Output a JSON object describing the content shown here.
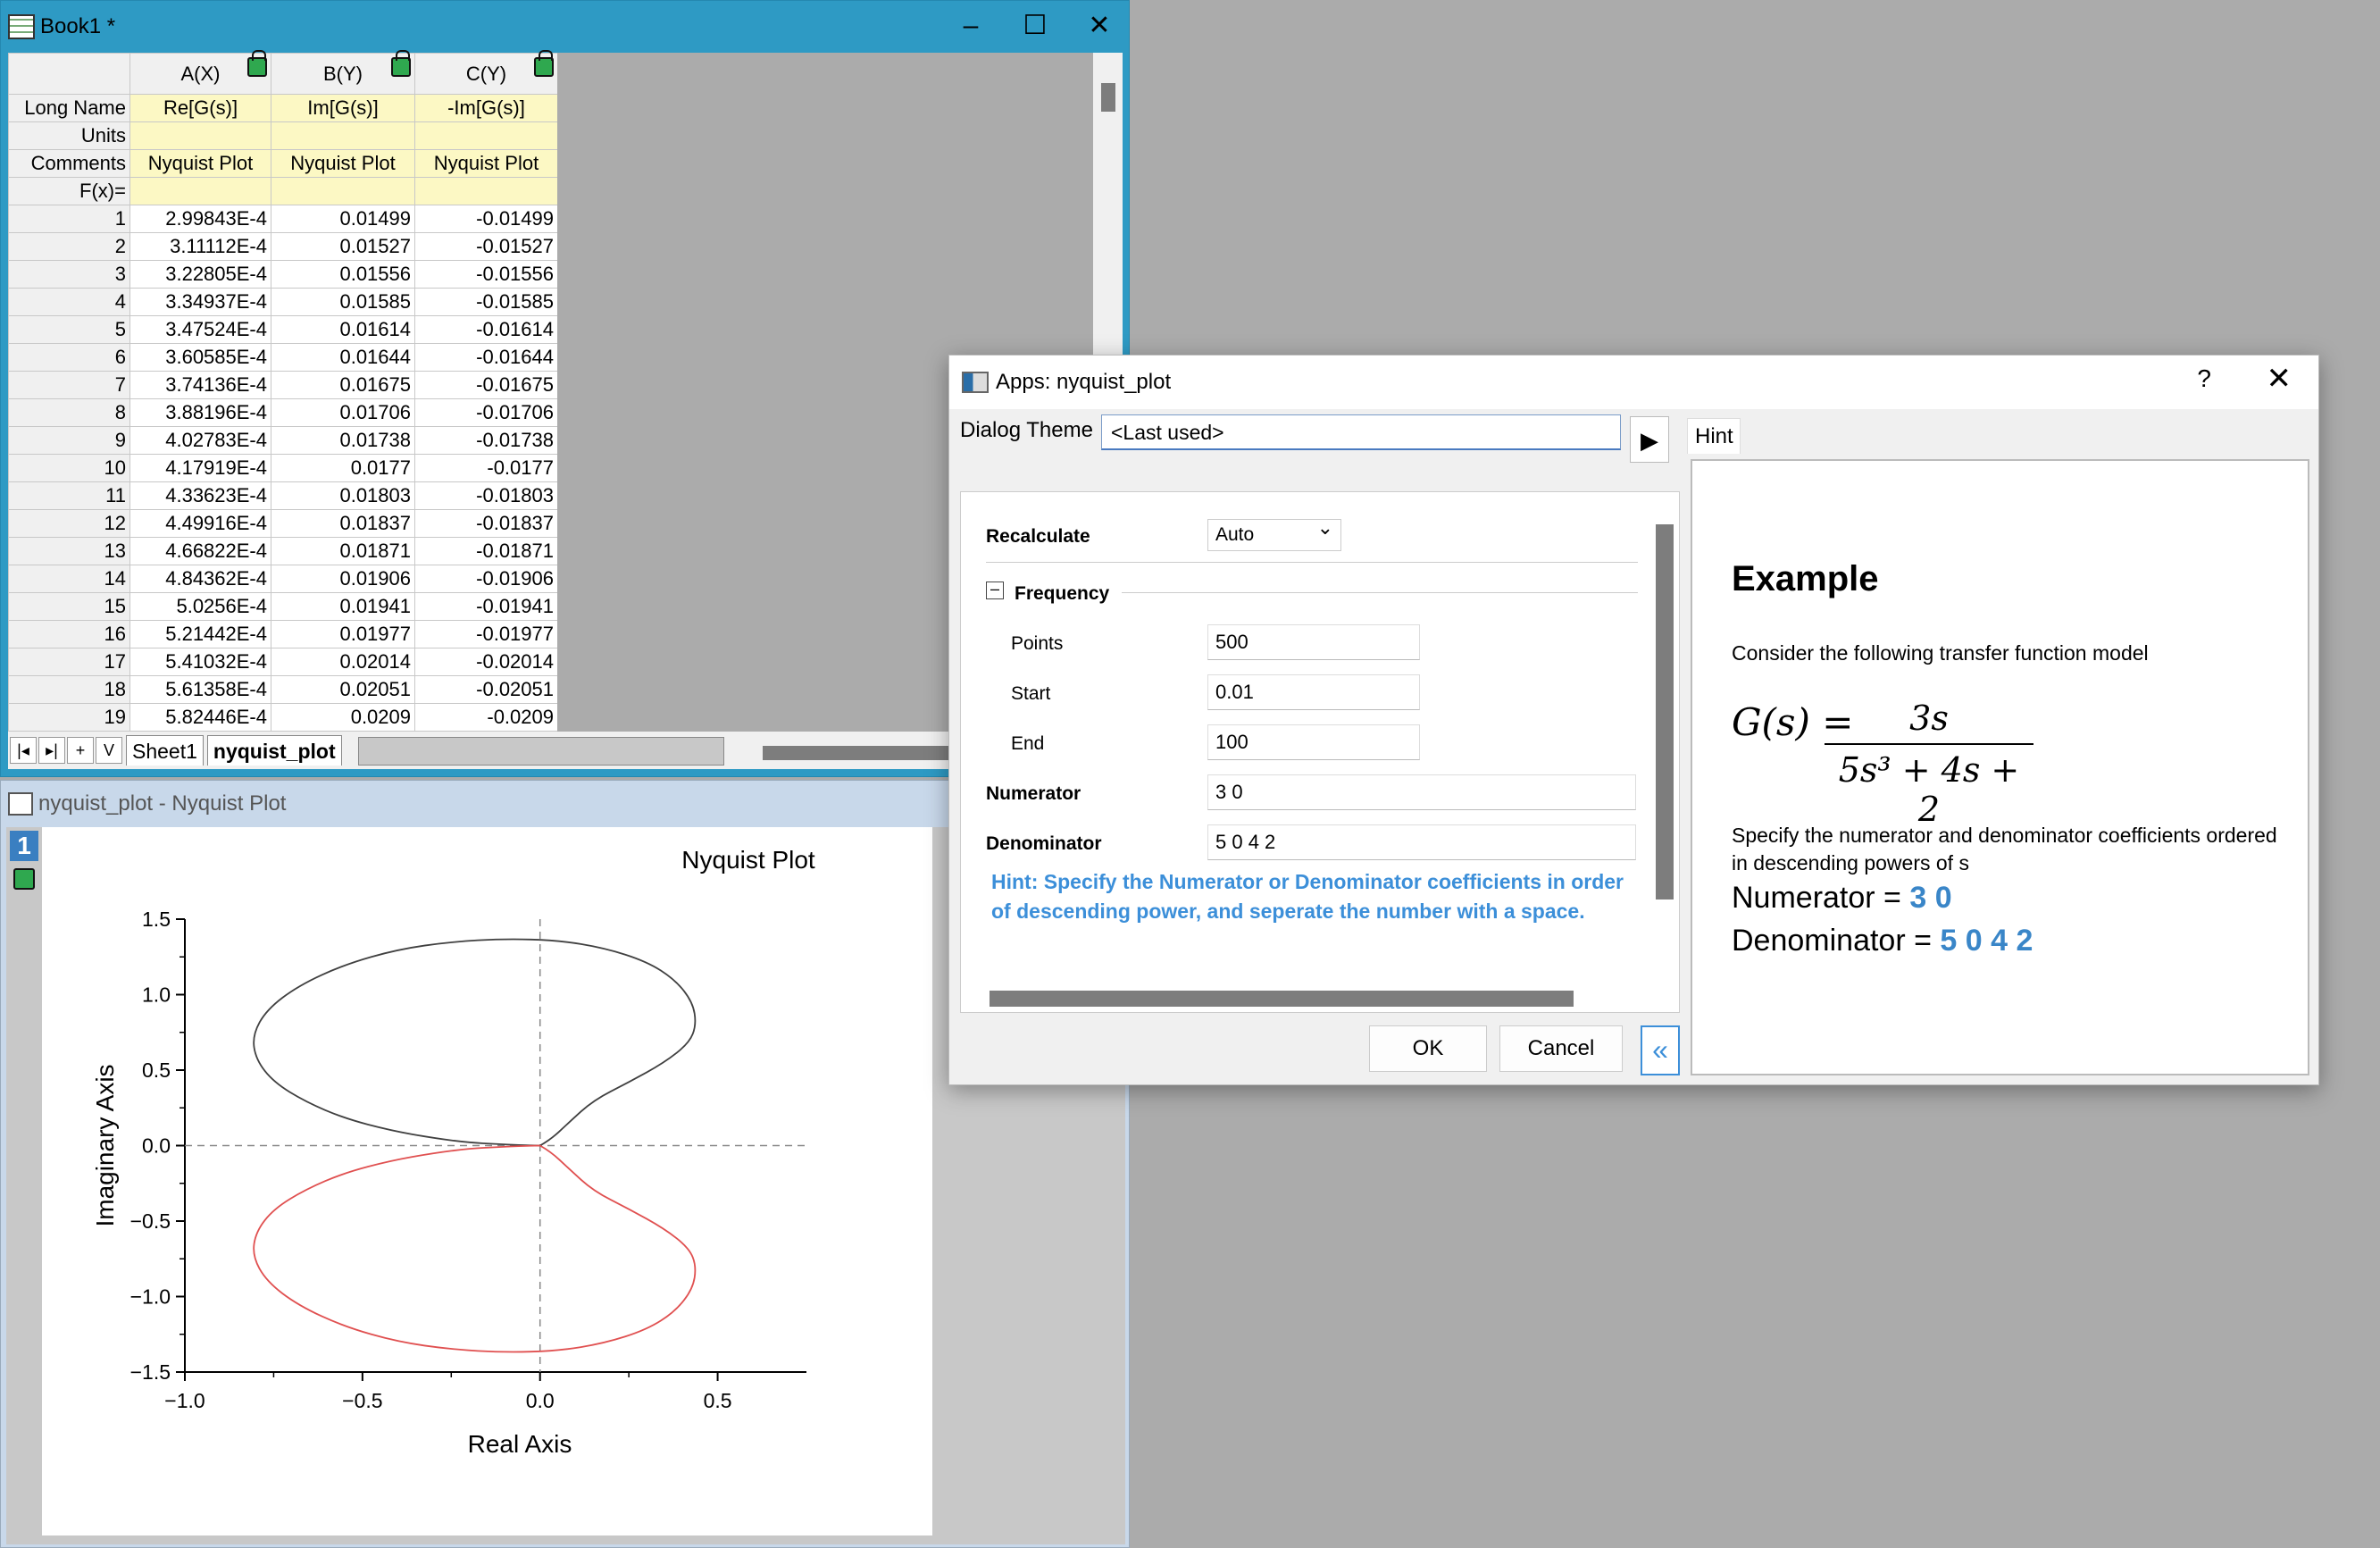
{
  "book": {
    "title": "Book1 *",
    "columns": [
      {
        "header": "A(X)",
        "long_name": "Re[G(s)]",
        "units": "",
        "comments": "Nyquist Plot"
      },
      {
        "header": "B(Y)",
        "long_name": "Im[G(s)]",
        "units": "",
        "comments": "Nyquist Plot"
      },
      {
        "header": "C(Y)",
        "long_name": "-Im[G(s)]",
        "units": "",
        "comments": "Nyquist Plot"
      }
    ],
    "row_labels": {
      "long_name": "Long Name",
      "units": "Units",
      "comments": "Comments",
      "fx": "F(x)="
    },
    "rows": [
      [
        "1",
        "2.99843E-4",
        "0.01499",
        "-0.01499"
      ],
      [
        "2",
        "3.11112E-4",
        "0.01527",
        "-0.01527"
      ],
      [
        "3",
        "3.22805E-4",
        "0.01556",
        "-0.01556"
      ],
      [
        "4",
        "3.34937E-4",
        "0.01585",
        "-0.01585"
      ],
      [
        "5",
        "3.47524E-4",
        "0.01614",
        "-0.01614"
      ],
      [
        "6",
        "3.60585E-4",
        "0.01644",
        "-0.01644"
      ],
      [
        "7",
        "3.74136E-4",
        "0.01675",
        "-0.01675"
      ],
      [
        "8",
        "3.88196E-4",
        "0.01706",
        "-0.01706"
      ],
      [
        "9",
        "4.02783E-4",
        "0.01738",
        "-0.01738"
      ],
      [
        "10",
        "4.17919E-4",
        "0.0177",
        "-0.0177"
      ],
      [
        "11",
        "4.33623E-4",
        "0.01803",
        "-0.01803"
      ],
      [
        "12",
        "4.49916E-4",
        "0.01837",
        "-0.01837"
      ],
      [
        "13",
        "4.66822E-4",
        "0.01871",
        "-0.01871"
      ],
      [
        "14",
        "4.84362E-4",
        "0.01906",
        "-0.01906"
      ],
      [
        "15",
        "5.0256E-4",
        "0.01941",
        "-0.01941"
      ],
      [
        "16",
        "5.21442E-4",
        "0.01977",
        "-0.01977"
      ],
      [
        "17",
        "5.41032E-4",
        "0.02014",
        "-0.02014"
      ],
      [
        "18",
        "5.61358E-4",
        "0.02051",
        "-0.02051"
      ],
      [
        "19",
        "5.82446E-4",
        "0.0209",
        "-0.0209"
      ]
    ],
    "tabs": [
      "Sheet1",
      "nyquist_plot"
    ],
    "nav": [
      "|◂",
      "▸|",
      "+",
      "V"
    ]
  },
  "graph": {
    "title": "nyquist_plot - Nyquist Plot",
    "layer_number": "1"
  },
  "chart_data": {
    "type": "line",
    "title": "Nyquist Plot",
    "xlabel": "Real Axis",
    "ylabel": "Imaginary Axis",
    "xlim": [
      -1.0,
      0.75
    ],
    "ylim": [
      -1.5,
      1.5
    ],
    "xticks": [
      "−1.0",
      "−0.5",
      "0.0",
      "0.5"
    ],
    "xtick_values": [
      -1.0,
      -0.5,
      0.0,
      0.5
    ],
    "yticks": [
      "1.5",
      "1.0",
      "0.5",
      "0.0",
      "−0.5",
      "−1.0",
      "−1.5"
    ],
    "ytick_values": [
      1.5,
      1.0,
      0.5,
      0.0,
      -0.5,
      -1.0,
      -1.5
    ],
    "grid": false,
    "reference_lines": {
      "x": 0.0,
      "y": 0.0
    },
    "series": [
      {
        "color": "#404040",
        "x": [
          0.0,
          0.03,
          0.08,
          0.15,
          0.25,
          0.35,
          0.42,
          0.44,
          0.43,
          0.38,
          0.3,
          0.18,
          0.05,
          -0.1,
          -0.25,
          -0.4,
          -0.55,
          -0.68,
          -0.77,
          -0.81,
          -0.8,
          -0.75,
          -0.66,
          -0.55,
          -0.42,
          -0.3,
          -0.2,
          -0.12,
          -0.06,
          0.0
        ],
        "y": [
          0.0,
          0.04,
          0.15,
          0.3,
          0.42,
          0.55,
          0.68,
          0.8,
          0.95,
          1.1,
          1.22,
          1.31,
          1.36,
          1.37,
          1.35,
          1.3,
          1.2,
          1.06,
          0.9,
          0.73,
          0.57,
          0.42,
          0.29,
          0.18,
          0.1,
          0.05,
          0.02,
          0.01,
          0.003,
          0.0
        ]
      },
      {
        "color": "#e05050",
        "x": [
          0.0,
          0.03,
          0.08,
          0.15,
          0.25,
          0.35,
          0.42,
          0.44,
          0.43,
          0.38,
          0.3,
          0.18,
          0.05,
          -0.1,
          -0.25,
          -0.4,
          -0.55,
          -0.68,
          -0.77,
          -0.81,
          -0.8,
          -0.75,
          -0.66,
          -0.55,
          -0.42,
          -0.3,
          -0.2,
          -0.12,
          -0.06,
          0.0
        ],
        "y": [
          0.0,
          -0.04,
          -0.15,
          -0.3,
          -0.42,
          -0.55,
          -0.68,
          -0.8,
          -0.95,
          -1.1,
          -1.22,
          -1.31,
          -1.36,
          -1.37,
          -1.35,
          -1.3,
          -1.2,
          -1.06,
          -0.9,
          -0.73,
          -0.57,
          -0.42,
          -0.29,
          -0.18,
          -0.1,
          -0.05,
          -0.02,
          -0.01,
          -0.003,
          0.0
        ]
      }
    ]
  },
  "dialog": {
    "title": "Apps: nyquist_plot",
    "help": "?",
    "close": "✕",
    "theme_label": "Dialog Theme",
    "theme_value": "<Last used>",
    "play": "▶",
    "hint_tab": "Hint",
    "recalculate_label": "Recalculate",
    "recalculate_value": "Auto",
    "frequency_label": "Frequency",
    "points_label": "Points",
    "points_value": "500",
    "start_label": "Start",
    "start_value": "0.01",
    "end_label": "End",
    "end_value": "100",
    "numerator_label": "Numerator",
    "numerator_value": "3 0",
    "denominator_label": "Denominator",
    "denominator_value": "5 0 4 2",
    "hint_text": "Hint: Specify the Numerator or Denominator coefficients in order of descending power, and seperate the number with a space.",
    "ok": "OK",
    "cancel": "Cancel",
    "collapse": "«"
  },
  "hint_panel": {
    "heading": "Example",
    "intro": "Consider the following transfer function model",
    "formula_lhs": "G(s) =",
    "formula_num": "3s",
    "formula_den": "5s³ + 4s + 2",
    "specify": "Specify the numerator and denominator coefficients ordered in descending powers of s",
    "num_label": "Numerator = ",
    "num_value": "3 0",
    "den_label": "Denominator = ",
    "den_value": "5 0 4 2"
  }
}
